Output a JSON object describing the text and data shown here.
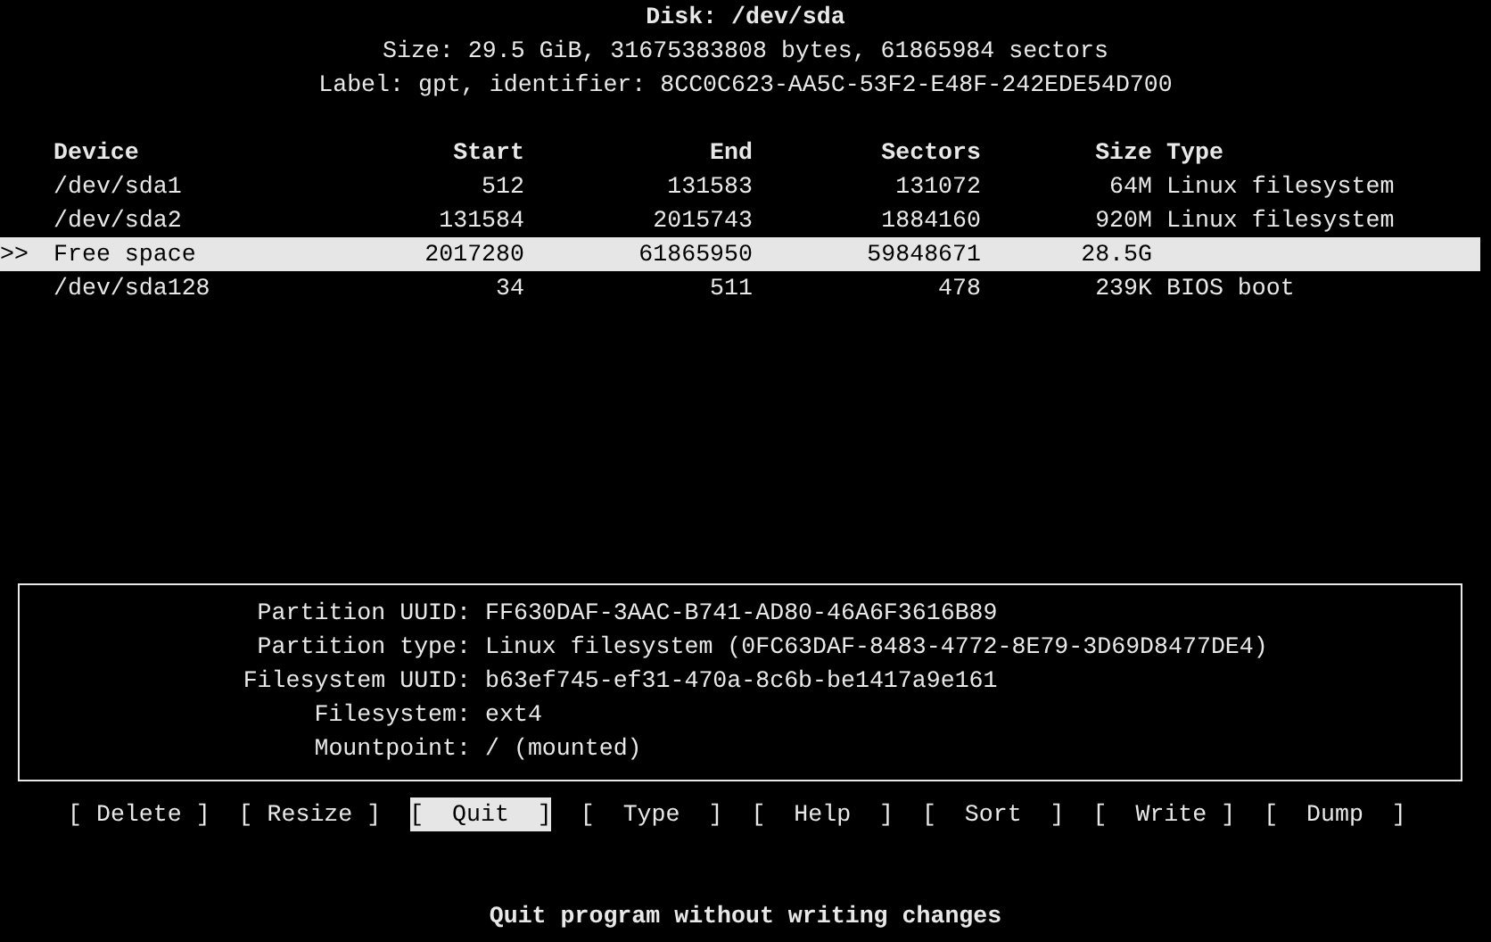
{
  "disk": {
    "title": "Disk: /dev/sda",
    "size_line": "Size: 29.5 GiB, 31675383808 bytes, 61865984 sectors",
    "label_line": "Label: gpt, identifier: 8CC0C623-AA5C-53F2-E48F-242EDE54D700"
  },
  "table": {
    "cursor": ">>",
    "columns": [
      "Device",
      "Start",
      "End",
      "Sectors",
      "Size",
      "Type"
    ],
    "rows": [
      {
        "selected": false,
        "cells": [
          "/dev/sda1",
          "512",
          "131583",
          "131072",
          "64M",
          "Linux filesystem"
        ]
      },
      {
        "selected": false,
        "cells": [
          "/dev/sda2",
          "131584",
          "2015743",
          "1884160",
          "920M",
          "Linux filesystem"
        ]
      },
      {
        "selected": true,
        "cells": [
          "Free space",
          "2017280",
          "61865950",
          "59848671",
          "28.5G",
          ""
        ]
      },
      {
        "selected": false,
        "cells": [
          "/dev/sda128",
          "34",
          "511",
          "478",
          "239K",
          "BIOS boot"
        ]
      }
    ]
  },
  "info": [
    {
      "label": "Partition UUID:",
      "value": "FF630DAF-3AAC-B741-AD80-46A6F3616B89"
    },
    {
      "label": "Partition type:",
      "value": "Linux filesystem (0FC63DAF-8483-4772-8E79-3D69D8477DE4)"
    },
    {
      "label": "Filesystem UUID:",
      "value": "b63ef745-ef31-470a-8c6b-be1417a9e161"
    },
    {
      "label": "Filesystem:",
      "value": "ext4"
    },
    {
      "label": "Mountpoint:",
      "value": "/ (mounted)"
    }
  ],
  "buttons": [
    {
      "label": "[ Delete ]",
      "selected": false
    },
    {
      "label": "[ Resize ]",
      "selected": false
    },
    {
      "label": "[  Quit  ]",
      "selected": true
    },
    {
      "label": "[  Type  ]",
      "selected": false
    },
    {
      "label": "[  Help  ]",
      "selected": false
    },
    {
      "label": "[  Sort  ]",
      "selected": false
    },
    {
      "label": "[  Write ]",
      "selected": false
    },
    {
      "label": "[  Dump  ]",
      "selected": false
    }
  ],
  "status": "Quit program without writing changes"
}
